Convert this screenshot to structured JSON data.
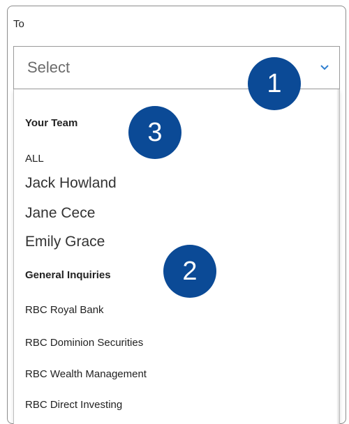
{
  "field": {
    "label": "To",
    "placeholder": "Select",
    "chevron_icon": "chevron-down-icon"
  },
  "menu": {
    "group1_heading": "Your Team",
    "group1_items": [
      "ALL",
      "Jack Howland",
      "Jane Cece",
      "Emily Grace"
    ],
    "group2_heading": "General Inquiries",
    "group2_items": [
      "RBC Royal Bank",
      "RBC Dominion Securities",
      "RBC Wealth Management",
      "RBC Direct Investing"
    ]
  },
  "callouts": [
    "1",
    "2",
    "3"
  ],
  "colors": {
    "accent": "#0b4a96",
    "chevron": "#2f7fd0"
  }
}
